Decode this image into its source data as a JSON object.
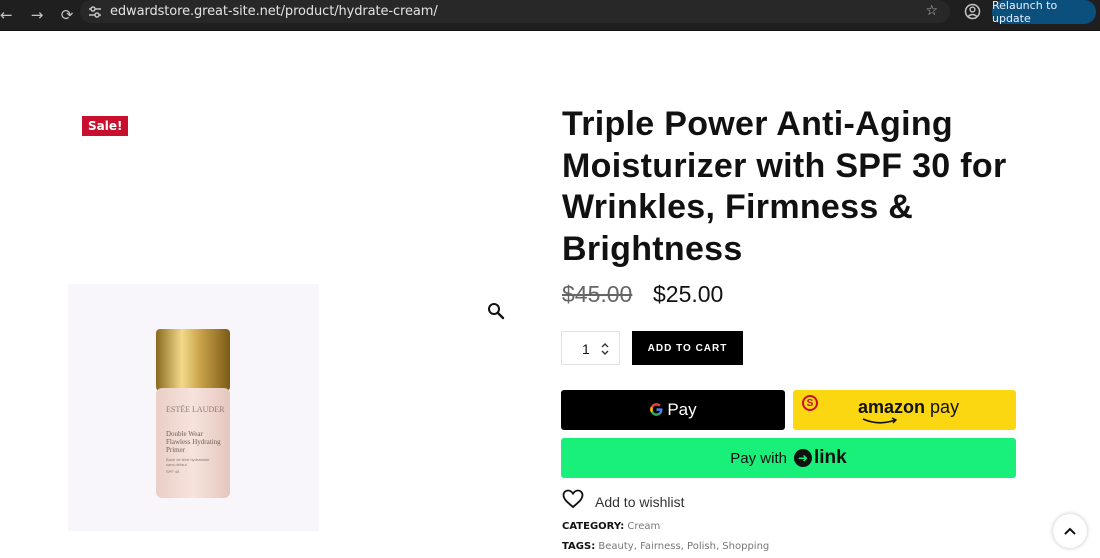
{
  "browser": {
    "url": "edwardstore.great-site.net/product/hydrate-cream/",
    "relaunch_label": "Relaunch to update",
    "icons": [
      "back-icon",
      "forward-icon",
      "reload-icon",
      "site-settings-icon",
      "bookmark-star-icon",
      "profile-icon"
    ]
  },
  "product": {
    "sale_badge": "Sale!",
    "title": "Triple Power Anti-Aging Moisturizer with SPF 30 for Wrinkles, Firmness & Brightness",
    "price_old": "$45.00",
    "price_new": "$25.00",
    "quantity": "1",
    "add_to_cart_label": "ADD TO CART",
    "image": {
      "brand": "ESTĒE LAUDER",
      "name_line1": "Double Wear",
      "name_line2": "Flawless Hydrating",
      "name_line3": "Primer",
      "sub_line1": "Base de teint hydratante",
      "sub_line2": "sans défaut",
      "spf": "SPF 45"
    }
  },
  "payments": {
    "gpay_label": "Pay",
    "amazon_word": "amazon",
    "amazon_pay": "pay",
    "amazon_badge": "S",
    "link_prefix": "Pay with",
    "link_word": "link"
  },
  "wishlist": {
    "label": "Add to wishlist"
  },
  "meta": {
    "category_label": "CATEGORY:",
    "category": "Cream",
    "tags_label": "TAGS:",
    "tags": [
      "Beauty",
      "Fairness",
      "Polish",
      "Shopping"
    ]
  },
  "colors": {
    "sale": "#c8102e",
    "gpay": "#000000",
    "amazon": "#fbd712",
    "link": "#18f07a"
  }
}
